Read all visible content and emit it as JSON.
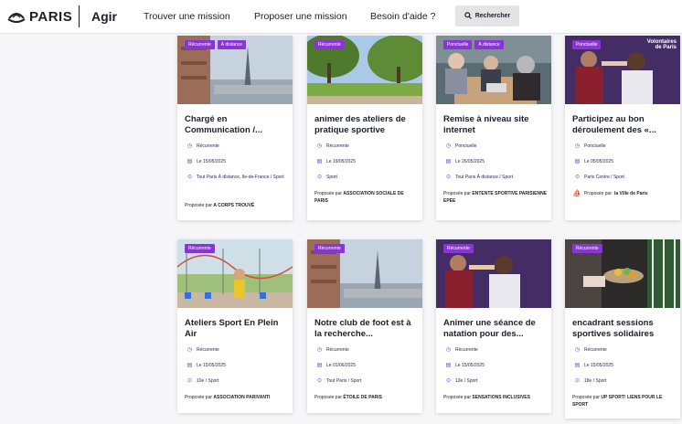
{
  "header": {
    "logo_text": "PARIS",
    "section": "Agir",
    "nav": [
      "Trouver une mission",
      "Proposer une mission",
      "Besoin d'aide ?"
    ],
    "search_label": "Rechercher"
  },
  "cards": [
    {
      "tags": [
        "Récurrente",
        "À distance"
      ],
      "title": "Chargé en Communication /...",
      "frequency": "Récurrente",
      "date": "Le 15/05/2025",
      "location": "Tout Paris À distance, Ile-de-France / Sport",
      "proposed_prefix": "Proposée par",
      "proposed_by": "A CORPS TROUVÉ"
    },
    {
      "tags": [
        "Récurrente"
      ],
      "title": "animer des ateliers de pratique sportive",
      "frequency": "Récurrente",
      "date": "Le 19/05/2025",
      "location": "Sport",
      "proposed_prefix": "Proposée par",
      "proposed_by": "ASSOCIATION SOCIALE DE PARIS"
    },
    {
      "tags": [
        "Ponctuelle",
        "À distance"
      ],
      "title": "Remise à niveau site internet",
      "frequency": "Ponctuelle",
      "date": "Le 26/05/2025",
      "location": "Tout Paris À distance / Sport",
      "proposed_prefix": "Proposée par",
      "proposed_by": "ENTENTE SPORTIVE PARISIENNE EPEE"
    },
    {
      "tags": [
        "Ponctuelle"
      ],
      "title": "Participez au bon déroulement des «...",
      "frequency": "Ponctuelle",
      "date": "Le 05/05/2025",
      "location": "Paris Centre / Sport",
      "proposed_prefix": "Proposée par",
      "proposed_by": "la Ville de Paris",
      "watermark": "Volontaires de Paris"
    },
    {
      "tags": [
        "Récurrente"
      ],
      "title": "Ateliers Sport En Plein Air",
      "frequency": "Récurrente",
      "date": "Le 15/05/2025",
      "location": "10e / Sport",
      "proposed_prefix": "Proposée par",
      "proposed_by": "ASSOCIATION PARIVANTI"
    },
    {
      "tags": [
        "Récurrente"
      ],
      "title": "Notre club de foot est à la recherche...",
      "frequency": "Récurrente",
      "date": "Le 01/06/2025",
      "location": "Tout Paris / Sport",
      "proposed_prefix": "Proposée par",
      "proposed_by": "ÉTOILE DE PARIS"
    },
    {
      "tags": [
        "Récurrente"
      ],
      "title": "Animer une séance de natation pour des...",
      "frequency": "Récurrente",
      "date": "Le 15/05/2025",
      "location": "13e / Sport",
      "proposed_prefix": "Proposée par",
      "proposed_by": "SENSATIONS INCLUSIVES"
    },
    {
      "tags": [
        "Récurrente"
      ],
      "title": "encadrant sessions sportives solidaires",
      "frequency": "Récurrente",
      "date": "Le 15/05/2025",
      "location": "18e / Sport",
      "proposed_prefix": "Proposée par",
      "proposed_by": "UP SPORT! LIENS POUR LE SPORT"
    }
  ],
  "icons": {
    "frequency": "clock-icon",
    "date": "calendar-icon",
    "location": "map-pin-icon",
    "logo": "paris-ship-icon",
    "search": "search-icon"
  },
  "colors": {
    "tag": "#8a34d6",
    "icon": "#4a4ad0",
    "search_bg": "#e4e4e6"
  }
}
